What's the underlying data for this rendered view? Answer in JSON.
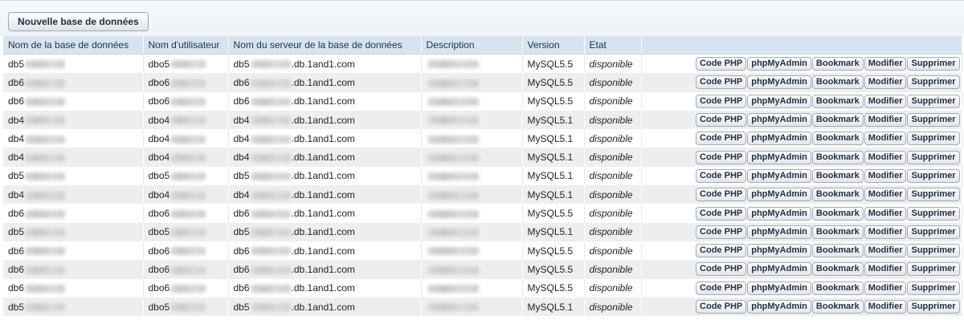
{
  "toolbar": {
    "new_db_label": "Nouvelle base de données"
  },
  "columns": [
    "Nom de la base de données",
    "Nom d'utilisateur",
    "Nom du serveur de la base de données",
    "Description",
    "Version",
    "Etat",
    ""
  ],
  "actions": [
    "Code PHP",
    "phpMyAdmin",
    "Bookmark",
    "Modifier",
    "Supprimer"
  ],
  "rows": [
    {
      "db": "db5",
      "user": "dbo5",
      "host_prefix": "db5",
      "host_suffix": ".db.1and1.com",
      "version": "MySQL5.5",
      "status": "disponible"
    },
    {
      "db": "db6",
      "user": "dbo6",
      "host_prefix": "db6",
      "host_suffix": ".db.1and1.com",
      "version": "MySQL5.5",
      "status": "disponible"
    },
    {
      "db": "db6",
      "user": "dbo6",
      "host_prefix": "db6",
      "host_suffix": ".db.1and1.com",
      "version": "MySQL5.5",
      "status": "disponible"
    },
    {
      "db": "db4",
      "user": "dbo4",
      "host_prefix": "db4",
      "host_suffix": ".db.1and1.com",
      "version": "MySQL5.1",
      "status": "disponible"
    },
    {
      "db": "db4",
      "user": "dbo4",
      "host_prefix": "db4",
      "host_suffix": ".db.1and1.com",
      "version": "MySQL5.1",
      "status": "disponible"
    },
    {
      "db": "db4",
      "user": "dbo4",
      "host_prefix": "db4",
      "host_suffix": ".db.1and1.com",
      "version": "MySQL5.1",
      "status": "disponible"
    },
    {
      "db": "db5",
      "user": "dbo5",
      "host_prefix": "db5",
      "host_suffix": ".db.1and1.com",
      "version": "MySQL5.1",
      "status": "disponible"
    },
    {
      "db": "db4",
      "user": "dbo4",
      "host_prefix": "db4",
      "host_suffix": ".db.1and1.com",
      "version": "MySQL5.1",
      "status": "disponible"
    },
    {
      "db": "db6",
      "user": "dbo6",
      "host_prefix": "db6",
      "host_suffix": ".db.1and1.com",
      "version": "MySQL5.5",
      "status": "disponible"
    },
    {
      "db": "db5",
      "user": "dbo5",
      "host_prefix": "db5",
      "host_suffix": ".db.1and1.com",
      "version": "MySQL5.1",
      "status": "disponible"
    },
    {
      "db": "db6",
      "user": "dbo6",
      "host_prefix": "db6",
      "host_suffix": ".db.1and1.com",
      "version": "MySQL5.5",
      "status": "disponible"
    },
    {
      "db": "db6",
      "user": "dbo6",
      "host_prefix": "db6",
      "host_suffix": ".db.1and1.com",
      "version": "MySQL5.5",
      "status": "disponible"
    },
    {
      "db": "db6",
      "user": "dbo6",
      "host_prefix": "db6",
      "host_suffix": ".db.1and1.com",
      "version": "MySQL5.5",
      "status": "disponible"
    },
    {
      "db": "db5",
      "user": "dbo5",
      "host_prefix": "db5",
      "host_suffix": ".db.1and1.com",
      "version": "MySQL5.1",
      "status": "disponible"
    }
  ]
}
